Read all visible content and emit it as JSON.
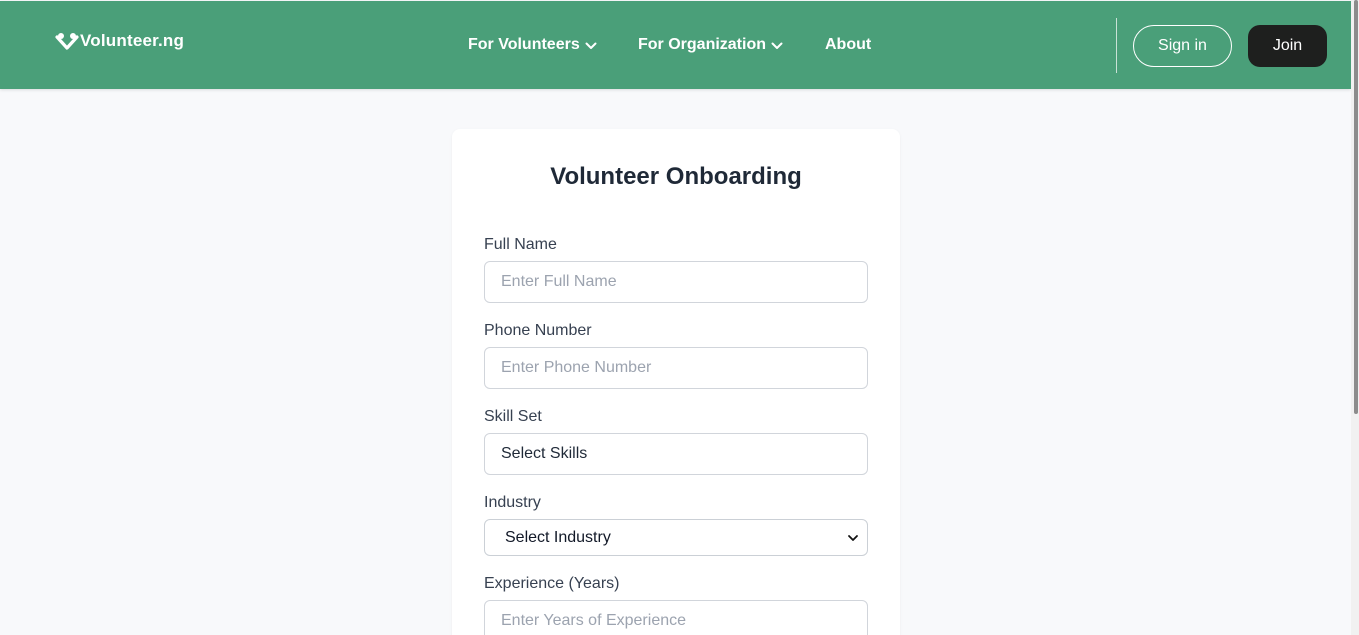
{
  "header": {
    "brand": "Volunteer.ng",
    "nav": [
      {
        "label": "For Volunteers",
        "icon": "chevron-down-icon"
      },
      {
        "label": "For Organization",
        "icon": "chevron-down-icon"
      },
      {
        "label": "About"
      }
    ],
    "signin_label": "Sign in",
    "join_label": "Join"
  },
  "form": {
    "title": "Volunteer Onboarding",
    "full_name": {
      "label": "Full Name",
      "placeholder": "Enter Full Name",
      "value": ""
    },
    "phone": {
      "label": "Phone Number",
      "placeholder": "Enter Phone Number",
      "value": ""
    },
    "skills": {
      "label": "Skill Set",
      "value": "Select Skills"
    },
    "industry": {
      "label": "Industry",
      "selected": "Select Industry"
    },
    "experience": {
      "label": "Experience (Years)",
      "placeholder": "Enter Years of Experience",
      "value": ""
    }
  },
  "colors": {
    "header_bg": "#4a9f79",
    "join_bg": "#1e1f1e",
    "page_bg": "#f8f9fb"
  }
}
